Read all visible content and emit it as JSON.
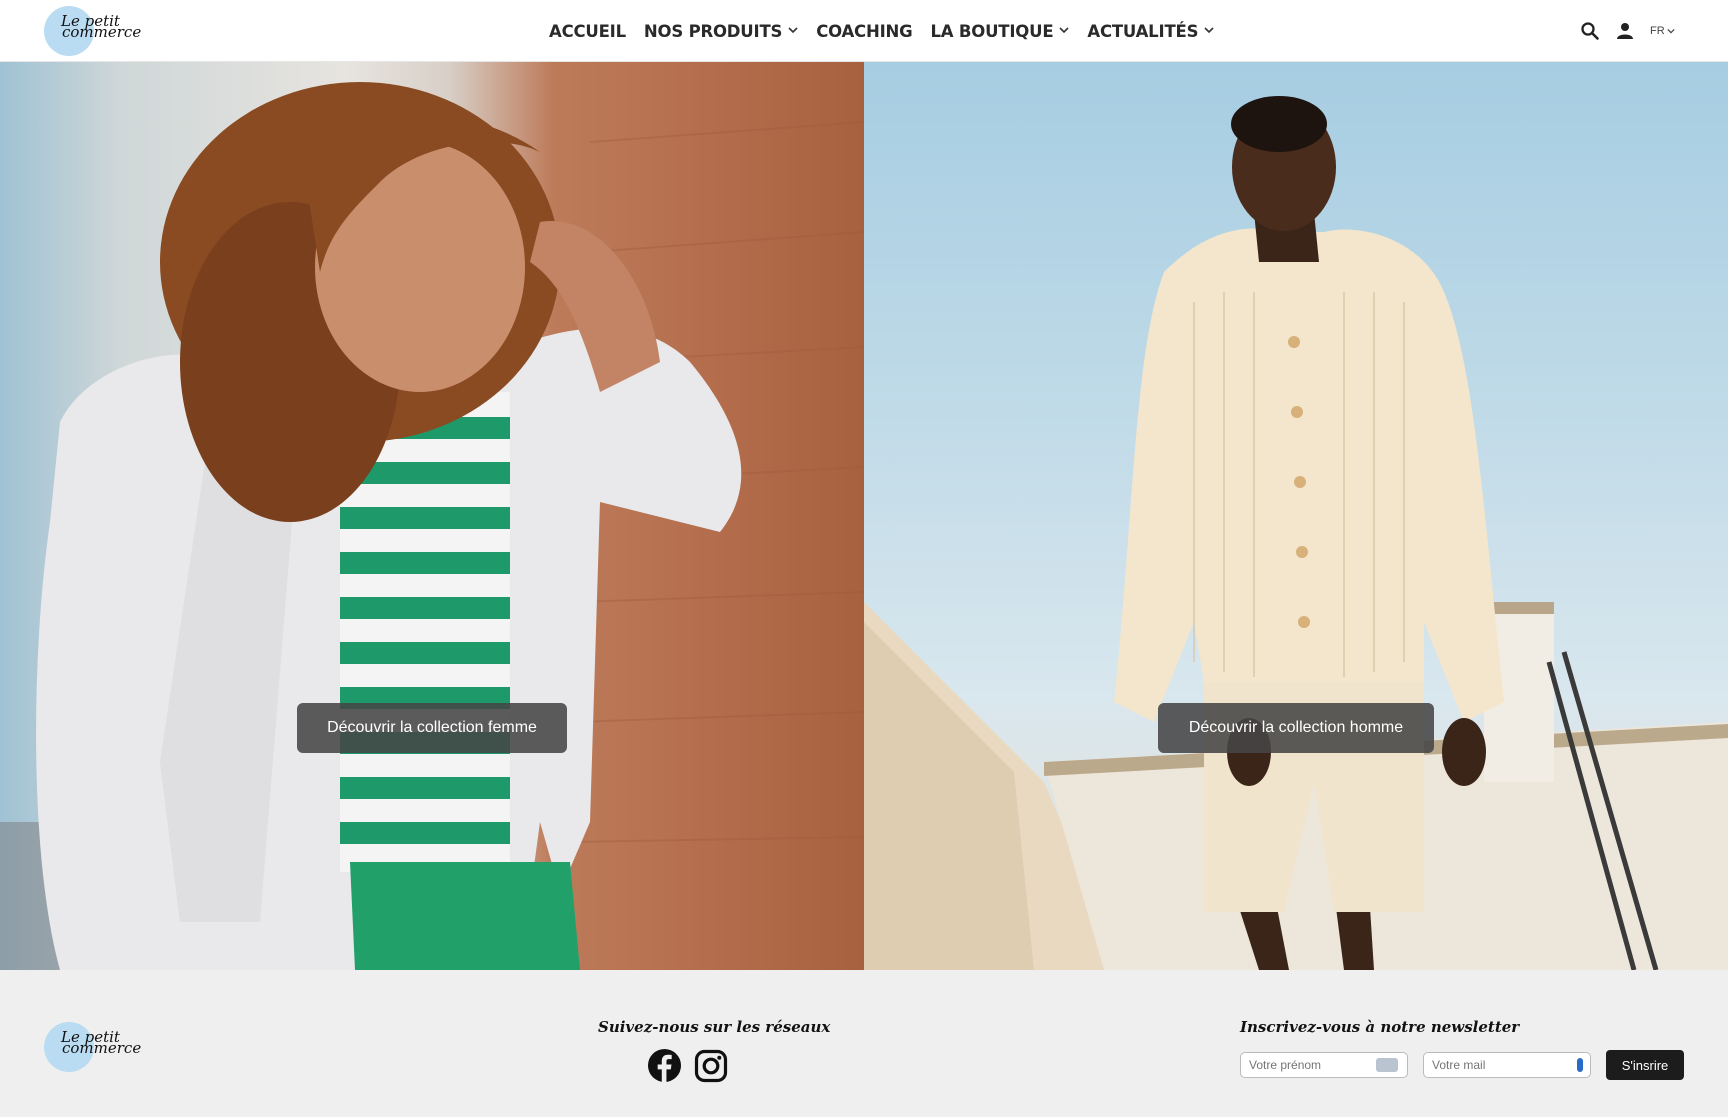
{
  "brand": {
    "logo_line1": "Le petit",
    "logo_line2": "commerce",
    "logo_color": "#b9dcf2"
  },
  "nav": {
    "items": [
      {
        "label": "ACCUEIL",
        "has_dropdown": false
      },
      {
        "label": "NOS PRODUITS",
        "has_dropdown": true
      },
      {
        "label": "COACHING",
        "has_dropdown": false
      },
      {
        "label": "LA BOUTIQUE",
        "has_dropdown": true
      },
      {
        "label": "ACTUALITÉS",
        "has_dropdown": true
      }
    ]
  },
  "header_icons": {
    "search": "search-icon",
    "account": "user-icon",
    "language": "FR"
  },
  "hero": {
    "women": {
      "cta_label": "Découvrir la collection femme"
    },
    "men": {
      "cta_label": "Découvrir la collection homme"
    }
  },
  "footer": {
    "social_title": "Suivez-nous sur les réseaux",
    "social_icons": [
      "facebook-icon",
      "instagram-icon"
    ],
    "newsletter_title": "Inscrivez-vous à notre newsletter",
    "firstname_placeholder": "Votre prénom",
    "email_placeholder": "Votre mail",
    "subscribe_label": "S'insrire"
  },
  "colors": {
    "accent_dark": "#1c1c1c",
    "footer_bg": "#efefef",
    "cta_bg": "#464646"
  }
}
